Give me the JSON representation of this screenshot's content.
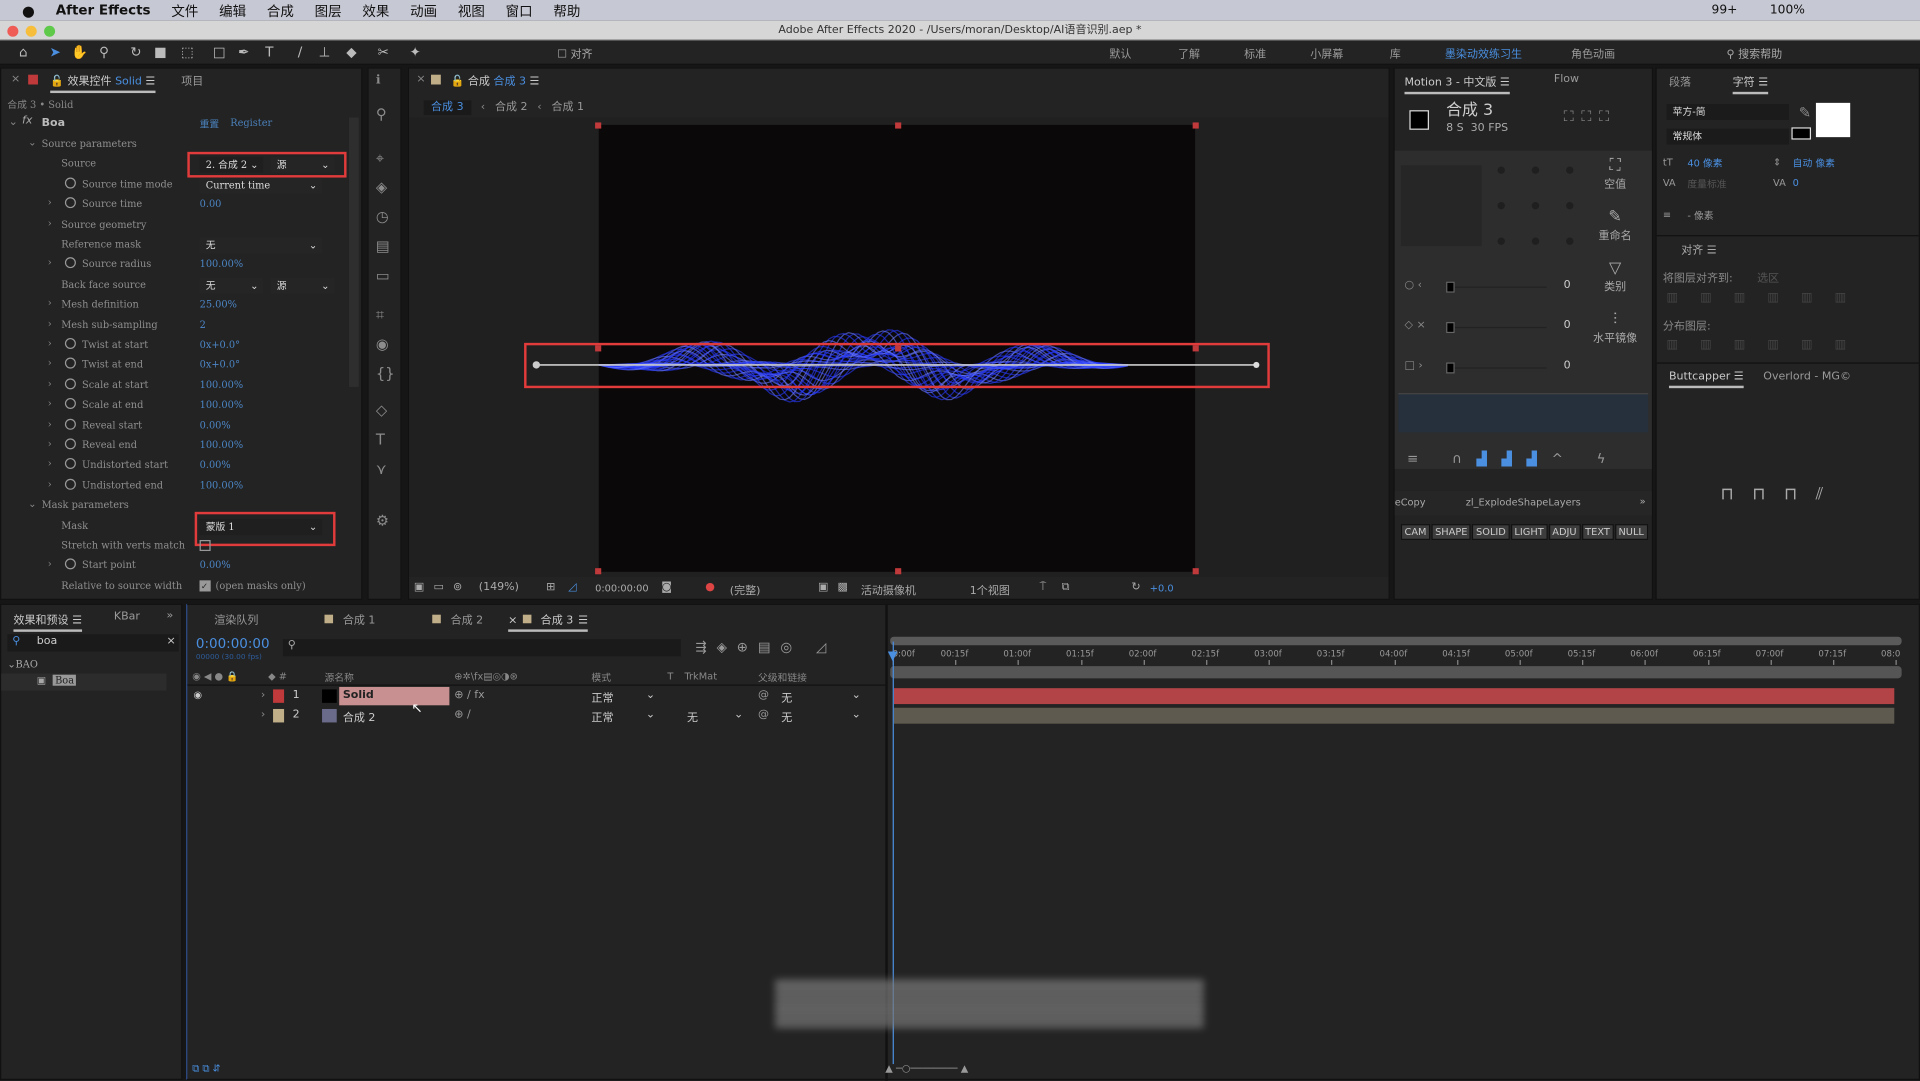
{
  "menubar": {
    "app": "After Effects",
    "items": [
      "文件",
      "编辑",
      "合成",
      "图层",
      "效果",
      "动画",
      "视图",
      "窗口",
      "帮助"
    ],
    "status": {
      "notifications": "99+",
      "battery": "100%"
    }
  },
  "window": {
    "title": "Adobe After Effects 2020 - /Users/moran/Desktop/AI语音识别.aep *"
  },
  "toolbar": {
    "align_label": "对齐",
    "workspaces": [
      "默认",
      "了解",
      "标准",
      "小屏幕",
      "库",
      "墨染动效练习生",
      "角色动画"
    ],
    "active_workspace": "墨染动效练习生",
    "search_help": "搜索帮助"
  },
  "effect_controls": {
    "tab_label": "效果控件",
    "tab_layer": "Solid",
    "tab_project": "项目",
    "breadcrumb": "合成 3 • Solid",
    "effect_name": "Boa",
    "reset": "重置",
    "register": "Register",
    "rows": [
      {
        "label": "Source parameters",
        "group": true
      },
      {
        "label": "Source",
        "dropdown": "2. 合成 2",
        "dropdown2": "源",
        "highlight": true
      },
      {
        "label": "Source time mode",
        "dropdown": "Current time",
        "stopwatch": true
      },
      {
        "label": "Source time",
        "value": "0.00",
        "stopwatch": true,
        "expand": true
      },
      {
        "label": "Source geometry",
        "expand": true
      },
      {
        "label": "Reference mask",
        "dropdown": "无"
      },
      {
        "label": "Source radius",
        "value": "100.00%",
        "stopwatch": true,
        "expand": true
      },
      {
        "label": "Back face source",
        "dropdown": "无",
        "dropdown2": "源"
      },
      {
        "label": "Mesh definition",
        "value": "25.00%",
        "expand": true
      },
      {
        "label": "Mesh sub-sampling",
        "value": "2",
        "expand": true
      },
      {
        "label": "Twist at start",
        "value": "0x+0.0°",
        "stopwatch": true,
        "expand": true
      },
      {
        "label": "Twist at end",
        "value": "0x+0.0°",
        "stopwatch": true,
        "expand": true
      },
      {
        "label": "Scale at start",
        "value": "100.00%",
        "stopwatch": true,
        "expand": true
      },
      {
        "label": "Scale at end",
        "value": "100.00%",
        "stopwatch": true,
        "expand": true
      },
      {
        "label": "Reveal start",
        "value": "0.00%",
        "stopwatch": true,
        "expand": true
      },
      {
        "label": "Reveal end",
        "value": "100.00%",
        "stopwatch": true,
        "expand": true
      },
      {
        "label": "Undistorted start",
        "value": "0.00%",
        "stopwatch": true,
        "expand": true
      },
      {
        "label": "Undistorted end",
        "value": "100.00%",
        "stopwatch": true,
        "expand": true
      },
      {
        "label": "Mask parameters",
        "group": true
      },
      {
        "label": "Mask",
        "dropdown": "蒙版 1",
        "highlight": true
      },
      {
        "label": "Stretch with verts match",
        "checkbox": false
      },
      {
        "label": "Start point",
        "value": "0.00%",
        "stopwatch": true,
        "expand": true
      },
      {
        "label": "Relative to source width",
        "checkbox": true,
        "checkbox_label": "(open masks only)"
      }
    ]
  },
  "composition": {
    "tab_prefix": "合成",
    "tab_name": "合成 3",
    "breadcrumbs": [
      "合成 3",
      "合成 2",
      "合成 1"
    ],
    "zoom": "(149%)",
    "time": "0:00:00:00",
    "resolution": "(完整)",
    "camera": "活动摄像机",
    "views": "1个视图",
    "exposure": "+0.0"
  },
  "motion_panel": {
    "tab": "Motion 3 - 中文版",
    "tab2": "Flow",
    "comp_name": "合成 3",
    "duration": "8 S",
    "fps": "30 FPS",
    "actions": [
      "空值",
      "重命名",
      "类别",
      "水平镜像"
    ],
    "slider_values": [
      "0",
      "0",
      "0"
    ],
    "scripts": [
      "eCopy",
      "zl_ExplodeShapeLayers"
    ],
    "layer_buttons": [
      "CAM",
      "SHAPE",
      "SOLID",
      "LIGHT",
      "ADJU",
      "TEXT",
      "NULL"
    ]
  },
  "character_panel": {
    "tab_paragraph": "段落",
    "tab_character": "字符",
    "font": "苹方-简",
    "style": "常规体",
    "size": "40 像素",
    "leading": "自动 像素",
    "kerning": "度量标准",
    "tracking": "0",
    "stroke": "- 像素",
    "align_title": "对齐",
    "align_to_label": "将图层对齐到:",
    "align_to_value": "选区",
    "distribute_label": "分布图层:",
    "buttcapper_tab": "Buttcapper",
    "overlord_tab": "Overlord - MG©"
  },
  "effects_presets": {
    "tab": "效果和预设",
    "tab2": "KBar",
    "search": "boa",
    "category": "BAO",
    "item": "Boa"
  },
  "timeline": {
    "tabs": [
      "渲染队列",
      "合成 1",
      "合成 2",
      "合成 3"
    ],
    "active_tab": "合成 3",
    "timecode": "0:00:00:00",
    "fps_info": "00000 (30.00 fps)",
    "columns": {
      "source_name": "源名称",
      "mode": "模式",
      "trkmat_t": "T",
      "trkmat": "TrkMat",
      "parent": "父级和链接"
    },
    "layers": [
      {
        "num": "1",
        "name": "Solid",
        "label_color": "#c0393b",
        "mode": "正常",
        "trkmat": "",
        "parent": "无",
        "selected": true,
        "bar_color": "#b24447"
      },
      {
        "num": "2",
        "name": "合成 2",
        "label_color": "#bfae88",
        "mode": "正常",
        "trkmat": "无",
        "parent": "无",
        "selected": false,
        "bar_color": "#5f5a4f"
      }
    ],
    "ruler": [
      "0:00f",
      "00:15f",
      "01:00f",
      "01:15f",
      "02:00f",
      "02:15f",
      "03:00f",
      "03:15f",
      "04:00f",
      "04:15f",
      "05:00f",
      "05:15f",
      "06:00f",
      "06:15f",
      "07:00f",
      "07:15f",
      "08:0"
    ]
  },
  "colors": {
    "accent": "#4a8fe0",
    "highlight_red": "#e23b3b",
    "wave_blue": "#2a3cff"
  }
}
